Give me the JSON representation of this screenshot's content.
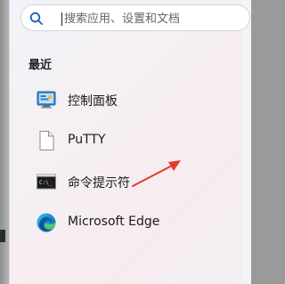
{
  "search": {
    "placeholder": "搜索应用、设置和文档"
  },
  "recent": {
    "title": "最近",
    "items": [
      {
        "label": "控制面板",
        "icon": "control-panel-icon"
      },
      {
        "label": "PuTTY",
        "icon": "blank-document-icon"
      },
      {
        "label": "命令提示符",
        "icon": "command-prompt-icon"
      },
      {
        "label": "Microsoft Edge",
        "icon": "microsoft-edge-icon"
      }
    ]
  },
  "colors": {
    "annotation_arrow": "#e23a2e",
    "search_icon": "#1a5fb4"
  }
}
